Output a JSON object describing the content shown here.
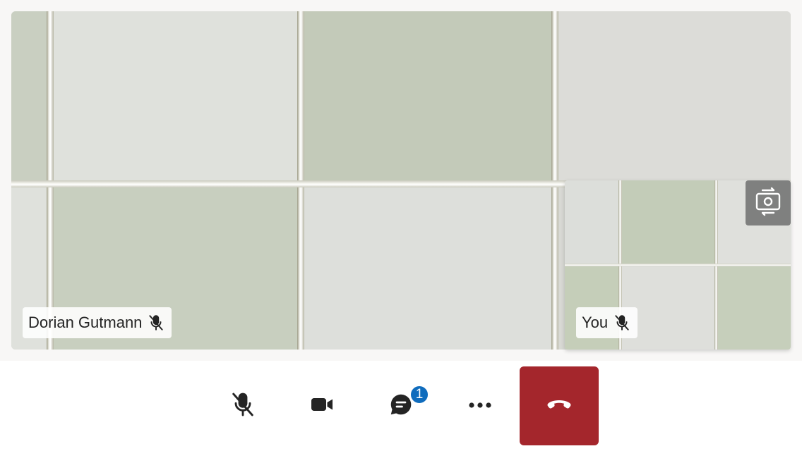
{
  "remote": {
    "participant_name": "Dorian Gutmann",
    "mic_status_icon": "mic-off-icon"
  },
  "local": {
    "label": "You",
    "mic_status_icon": "mic-off-icon",
    "switch_camera_icon": "camera-switch-icon"
  },
  "controls": {
    "microphone_icon": "mic-off-icon",
    "camera_icon": "video-camera-icon",
    "chat_icon": "chat-icon",
    "chat_unread_count": "1",
    "more_icon": "more-horizontal-icon",
    "hangup_icon": "phone-hangup-icon"
  },
  "colors": {
    "hangup_bg": "#a4262c",
    "badge_bg": "#0f6cbd",
    "tile_green": "#c4cbbb",
    "tile_white": "#dcdeda"
  }
}
